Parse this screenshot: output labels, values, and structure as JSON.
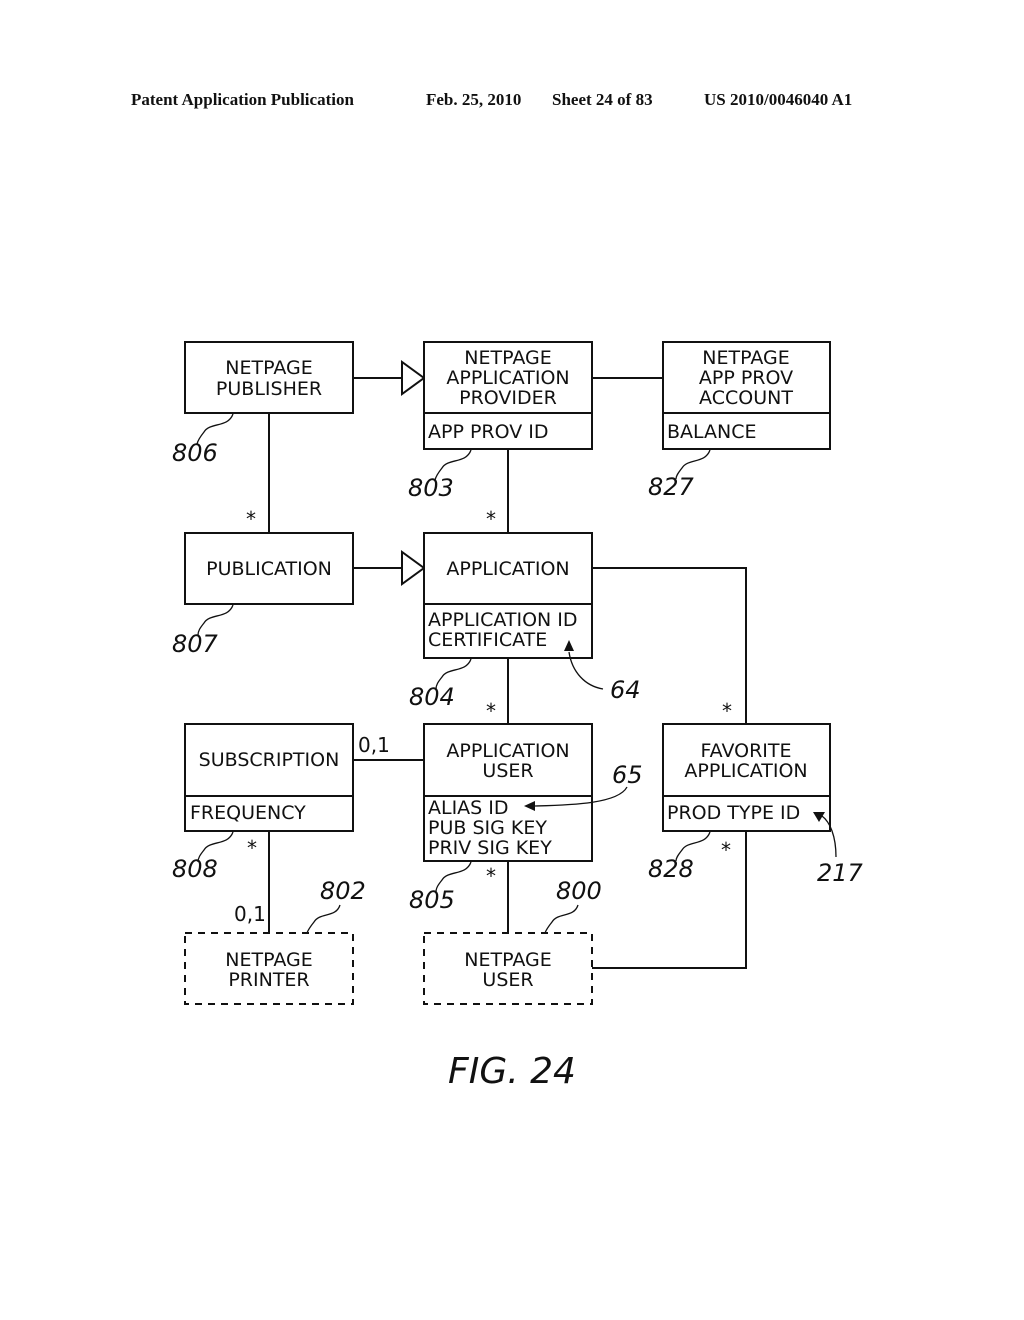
{
  "header": {
    "publication": "Patent Application Publication",
    "date": "Feb. 25, 2010",
    "sheet": "Sheet 24 of 83",
    "number": "US 2010/0046040 A1"
  },
  "figure_label": "FIG. 24",
  "classes": {
    "netpage_publisher": {
      "title": [
        "NETPAGE",
        "PUBLISHER"
      ],
      "attributes": [],
      "ref": "806"
    },
    "netpage_application_provider": {
      "title": [
        "NETPAGE",
        "APPLICATION",
        "PROVIDER"
      ],
      "attributes": [
        "APP PROV ID"
      ],
      "ref": "803"
    },
    "netpage_app_prov_account": {
      "title": [
        "NETPAGE",
        "APP PROV",
        "ACCOUNT"
      ],
      "attributes": [
        "BALANCE"
      ],
      "ref": "827"
    },
    "publication": {
      "title": [
        "PUBLICATION"
      ],
      "attributes": [],
      "ref": "807"
    },
    "application": {
      "title": [
        "APPLICATION"
      ],
      "attributes": [
        "APPLICATION ID",
        "CERTIFICATE"
      ],
      "ref": "804"
    },
    "subscription": {
      "title": [
        "SUBSCRIPTION"
      ],
      "attributes": [
        "FREQUENCY"
      ],
      "ref": "808"
    },
    "application_user": {
      "title": [
        "APPLICATION",
        "USER"
      ],
      "attributes": [
        "ALIAS ID",
        "PUB SIG KEY",
        "PRIV SIG KEY"
      ],
      "ref": "805"
    },
    "favorite_application": {
      "title": [
        "FAVORITE",
        "APPLICATION"
      ],
      "attributes": [
        "PROD TYPE ID"
      ],
      "ref": "828"
    },
    "netpage_printer": {
      "title": [
        "NETPAGE",
        "PRINTER"
      ],
      "attributes": [],
      "ref": "802",
      "external": true
    },
    "netpage_user": {
      "title": [
        "NETPAGE",
        "USER"
      ],
      "attributes": [],
      "ref": "800",
      "external": true
    }
  },
  "annotations": {
    "certificate_ref": "64",
    "alias_id_ref": "65",
    "prod_type_id_ref": "217"
  },
  "multiplicities": {
    "publisher_publication": "*",
    "provider_application": "*",
    "application_appuser": "*",
    "application_favorite": "*",
    "subscription_appuser": "0,1",
    "subscription_printer_top": "*",
    "subscription_printer_bottom": "0,1",
    "appuser_netpageuser": "*",
    "favorite_netpageuser": "*"
  },
  "relationships": [
    {
      "from": "NETPAGE PUBLISHER",
      "to": "NETPAGE APPLICATION PROVIDER",
      "type": "generalization"
    },
    {
      "from": "PUBLICATION",
      "to": "APPLICATION",
      "type": "generalization"
    },
    {
      "from": "NETPAGE APPLICATION PROVIDER",
      "to": "NETPAGE APP PROV ACCOUNT",
      "type": "association"
    },
    {
      "from": "NETPAGE PUBLISHER",
      "to": "PUBLICATION",
      "type": "association"
    },
    {
      "from": "NETPAGE APPLICATION PROVIDER",
      "to": "APPLICATION",
      "type": "association"
    },
    {
      "from": "APPLICATION",
      "to": "APPLICATION USER",
      "type": "association"
    },
    {
      "from": "APPLICATION",
      "to": "FAVORITE APPLICATION",
      "type": "association"
    },
    {
      "from": "SUBSCRIPTION",
      "to": "APPLICATION USER",
      "type": "association"
    },
    {
      "from": "SUBSCRIPTION",
      "to": "NETPAGE PRINTER",
      "type": "association"
    },
    {
      "from": "APPLICATION USER",
      "to": "NETPAGE USER",
      "type": "association"
    },
    {
      "from": "FAVORITE APPLICATION",
      "to": "NETPAGE USER",
      "type": "association"
    }
  ]
}
